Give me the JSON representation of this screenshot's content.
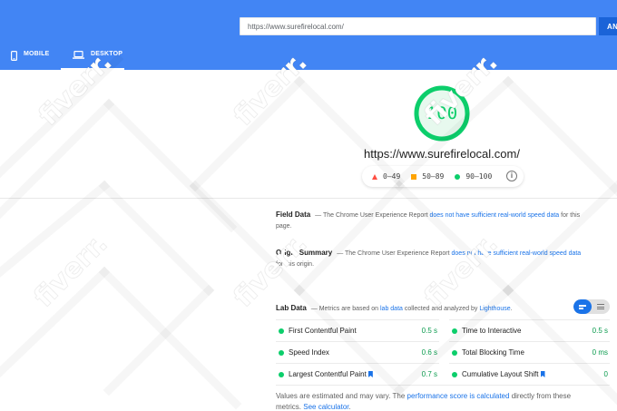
{
  "header": {
    "url_value": "https://www.surefirelocal.com/",
    "analyze_label": "ANA",
    "tabs": [
      {
        "label": "MOBILE",
        "icon": "smartphone-icon"
      },
      {
        "label": "DESKTOP",
        "icon": "laptop-icon",
        "active": true
      }
    ]
  },
  "score": {
    "value": "100",
    "fraction": 1.0,
    "color": "#0cce6b",
    "url": "https://www.surefirelocal.com/"
  },
  "legend": {
    "items": [
      {
        "label": "0–49",
        "color": "#ff4e42",
        "icon": "triangle-icon"
      },
      {
        "label": "50–89",
        "color": "#ffa400",
        "icon": "square-icon"
      },
      {
        "label": "90–100",
        "color": "#0cce6b",
        "icon": "circle-icon"
      }
    ],
    "info_icon": "i"
  },
  "field": {
    "title": "Field Data",
    "dash": " — ",
    "pre": "The Chrome User Experience Report ",
    "link": "does not have sufficient real-world speed data",
    "post": " for this page."
  },
  "origin": {
    "title": "Origin Summary",
    "dash": " — ",
    "pre": "The Chrome User Experience Report ",
    "link": "does not have sufficient real-world speed data",
    "post": " for this origin."
  },
  "lab": {
    "title": "Lab Data",
    "dash": " — ",
    "pre": "Metrics are based on ",
    "link1": "lab data",
    "mid": " collected and analyzed by ",
    "link2": "Lighthouse",
    "post": "."
  },
  "metrics": {
    "left": [
      {
        "name": "First Contentful Paint",
        "value": "0.5 s"
      },
      {
        "name": "Speed Index",
        "value": "0.6 s"
      },
      {
        "name": "Largest Contentful Paint",
        "value": "0.7 s"
      }
    ],
    "right": [
      {
        "name": "Time to Interactive",
        "value": "0.5 s"
      },
      {
        "name": "Total Blocking Time",
        "value": "0 ms"
      },
      {
        "name": "Cumulative Layout Shift",
        "value": "0"
      }
    ]
  },
  "footnote": {
    "pre": "Values are estimated and may vary. The ",
    "link1": "performance score is calculated",
    "mid": " directly from these metrics. ",
    "link2": "See calculator",
    "post": "."
  },
  "watermark": {
    "text": "fiverr."
  },
  "colors": {
    "header": "#4285f4",
    "pass": "#0cce6b",
    "link": "#1a73e8"
  }
}
